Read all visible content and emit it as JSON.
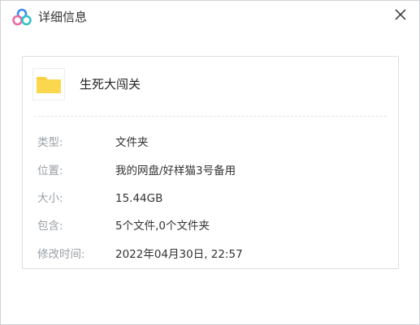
{
  "window": {
    "title": "详细信息",
    "logo_icon": "baidu-netdisk-cloud-icon",
    "close_icon": "close-icon"
  },
  "file": {
    "icon": "folder-icon",
    "name": "生死大闯关"
  },
  "details": [
    {
      "label": "类型:",
      "value": "文件夹"
    },
    {
      "label": "位置:",
      "value": "我的网盘/好样猫3号备用"
    },
    {
      "label": "大小:",
      "value": "15.44GB"
    },
    {
      "label": "包含:",
      "value": "5个文件,0个文件夹"
    },
    {
      "label": "修改时间:",
      "value": "2022年04月30日, 22:57"
    }
  ],
  "colors": {
    "logo_blue": "#3b8cf5",
    "logo_pink": "#e96aa4",
    "logo_teal": "#38c3c8",
    "folder_yellow": "#f9cf3f",
    "label_gray": "#9aa0a6",
    "text_dark": "#333333"
  }
}
